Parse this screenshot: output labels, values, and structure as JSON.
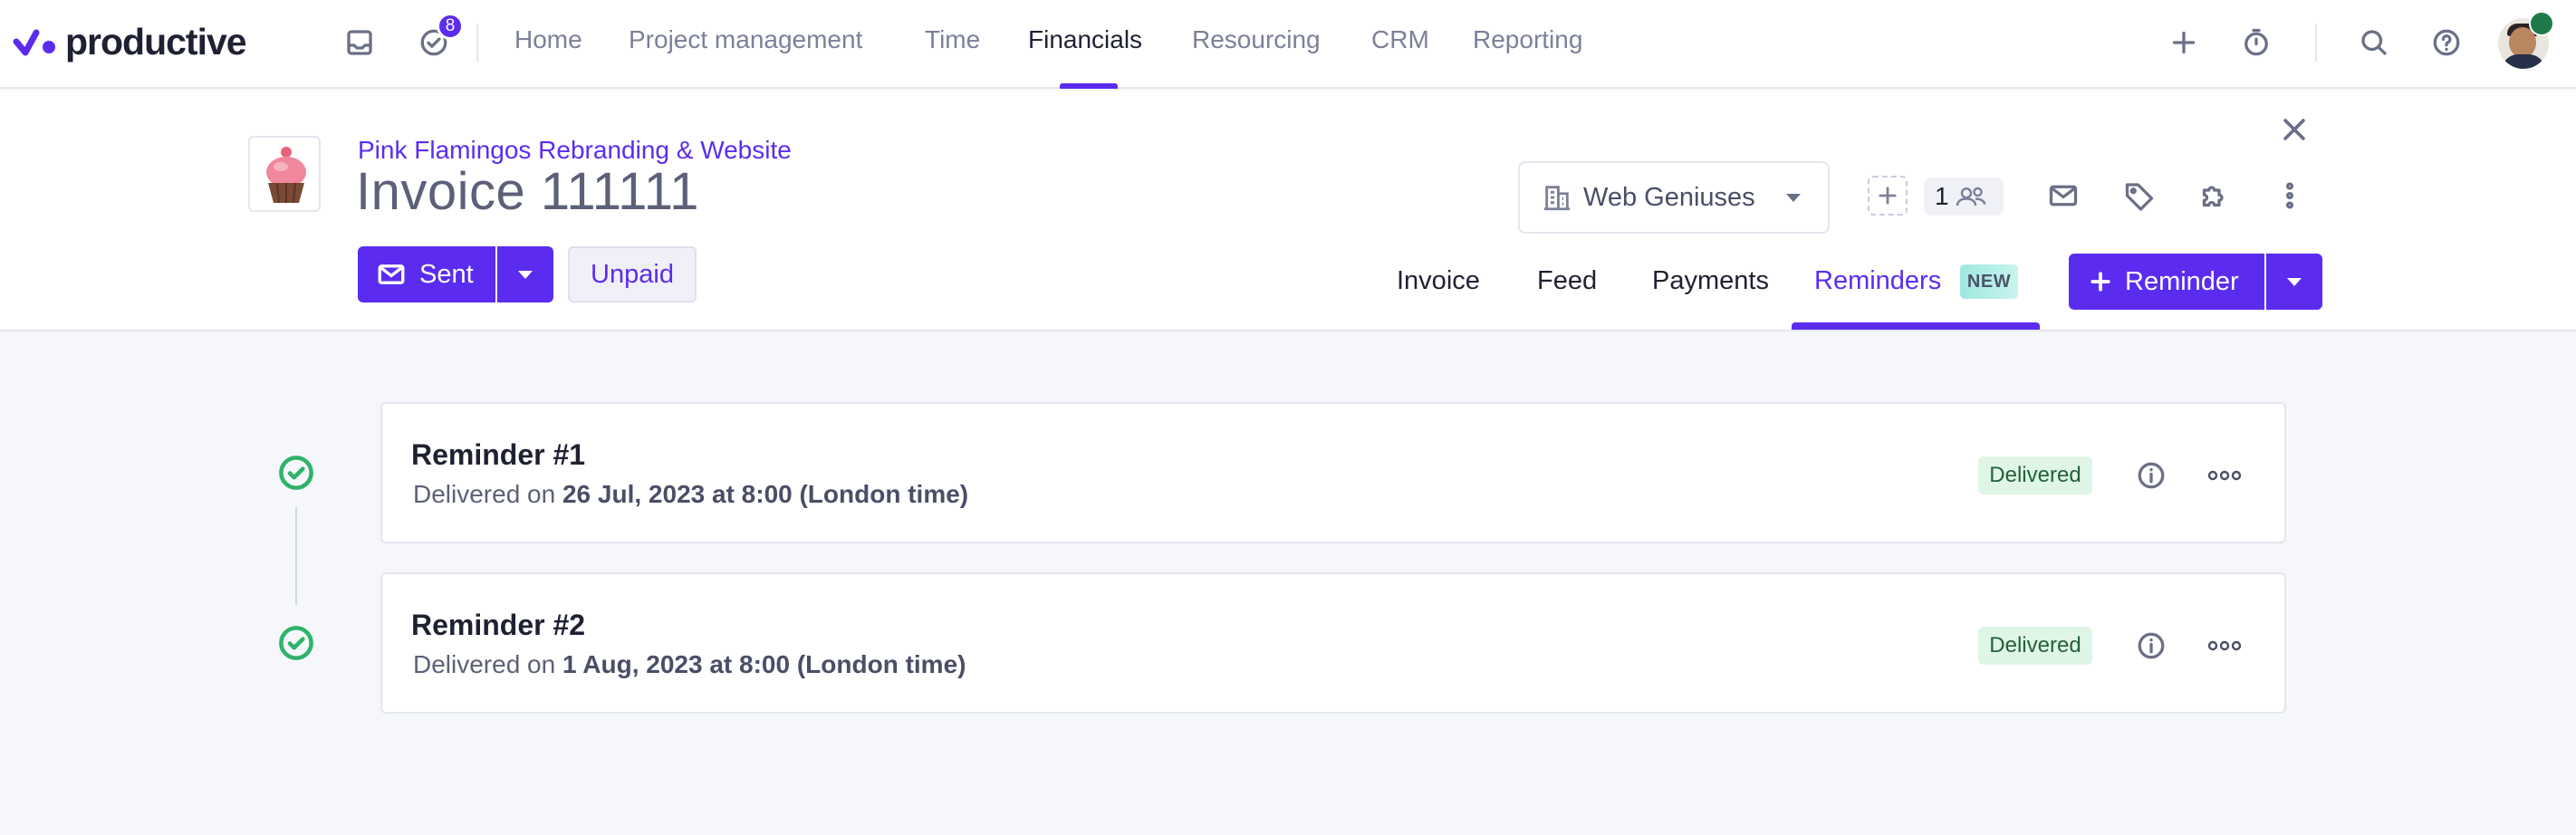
{
  "brand": {
    "name": "productive",
    "accent": "#5b2cf0"
  },
  "topnav": {
    "notifications_count": "8",
    "items": [
      {
        "label": "Home"
      },
      {
        "label": "Project management"
      },
      {
        "label": "Time"
      },
      {
        "label": "Financials",
        "active": true
      },
      {
        "label": "Resourcing"
      },
      {
        "label": "CRM"
      },
      {
        "label": "Reporting"
      }
    ],
    "icons": [
      "inbox-icon",
      "tasks-check-icon",
      "plus-icon",
      "timer-icon",
      "search-icon",
      "help-icon"
    ]
  },
  "invoice": {
    "project_name": "Pink Flamingos Rebranding & Website",
    "title": "Invoice 111111",
    "status_button": "Sent",
    "payment_status": "Unpaid",
    "company": "Web Geniuses",
    "subscribers_count": "1"
  },
  "tabs": [
    {
      "label": "Invoice"
    },
    {
      "label": "Feed"
    },
    {
      "label": "Payments"
    },
    {
      "label": "Reminders",
      "active": true,
      "badge": "NEW"
    }
  ],
  "actions": {
    "add_reminder": "Reminder"
  },
  "reminders": [
    {
      "title": "Reminder #1",
      "prefix": "Delivered on",
      "datetime": "26 Jul, 2023 at 8:00 (London time)",
      "status": "Delivered",
      "status_color": "#dff5e6"
    },
    {
      "title": "Reminder #2",
      "prefix": "Delivered on",
      "datetime": "1 Aug, 2023 at 8:00 (London time)",
      "status": "Delivered",
      "status_color": "#dff5e6"
    }
  ]
}
